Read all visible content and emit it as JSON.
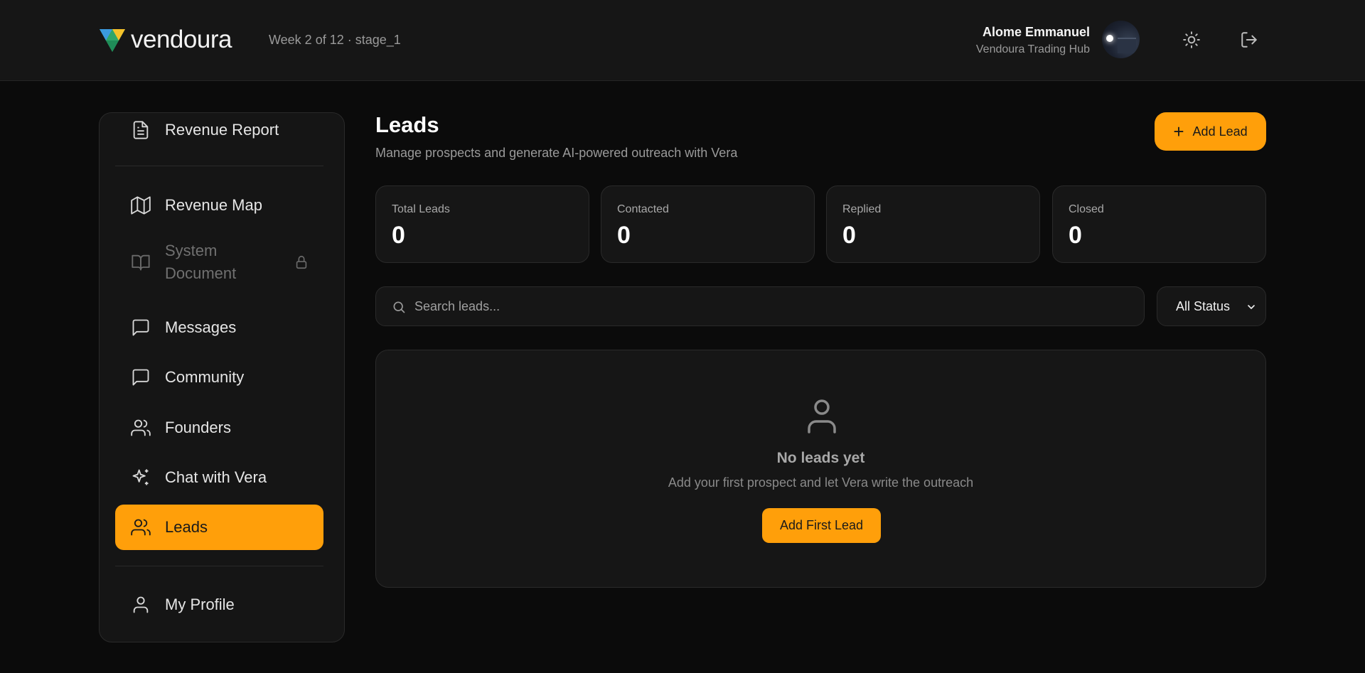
{
  "header": {
    "logo_text": "vendoura",
    "week_info": "Week 2 of 12 · stage_1",
    "user_name": "Alome Emmanuel",
    "user_org": "Vendoura Trading Hub"
  },
  "sidebar": {
    "items": [
      {
        "label": "Revenue Report",
        "icon": "document-icon"
      },
      {
        "label": "Revenue Map",
        "icon": "map-icon"
      },
      {
        "label": "System Document",
        "icon": "book-icon",
        "locked": true
      },
      {
        "label": "Messages",
        "icon": "message-icon"
      },
      {
        "label": "Community",
        "icon": "message-icon"
      },
      {
        "label": "Founders",
        "icon": "users-icon"
      },
      {
        "label": "Chat with Vera",
        "icon": "sparkle-icon"
      },
      {
        "label": "Leads",
        "icon": "users-icon",
        "active": true
      },
      {
        "label": "My Profile",
        "icon": "user-icon"
      }
    ]
  },
  "main": {
    "title": "Leads",
    "subtitle": "Manage prospects and generate AI-powered outreach with Vera",
    "add_button": "Add Lead",
    "stats": [
      {
        "label": "Total Leads",
        "value": "0"
      },
      {
        "label": "Contacted",
        "value": "0"
      },
      {
        "label": "Replied",
        "value": "0"
      },
      {
        "label": "Closed",
        "value": "0"
      }
    ],
    "search": {
      "placeholder": "Search leads...",
      "value": ""
    },
    "status_filter": "All Status",
    "empty": {
      "title": "No leads yet",
      "subtitle": "Add your first prospect and let Vera write the outreach",
      "button": "Add First Lead"
    }
  },
  "colors": {
    "accent": "#ff9f0a",
    "background": "#0b0b0b",
    "surface": "#161616"
  }
}
